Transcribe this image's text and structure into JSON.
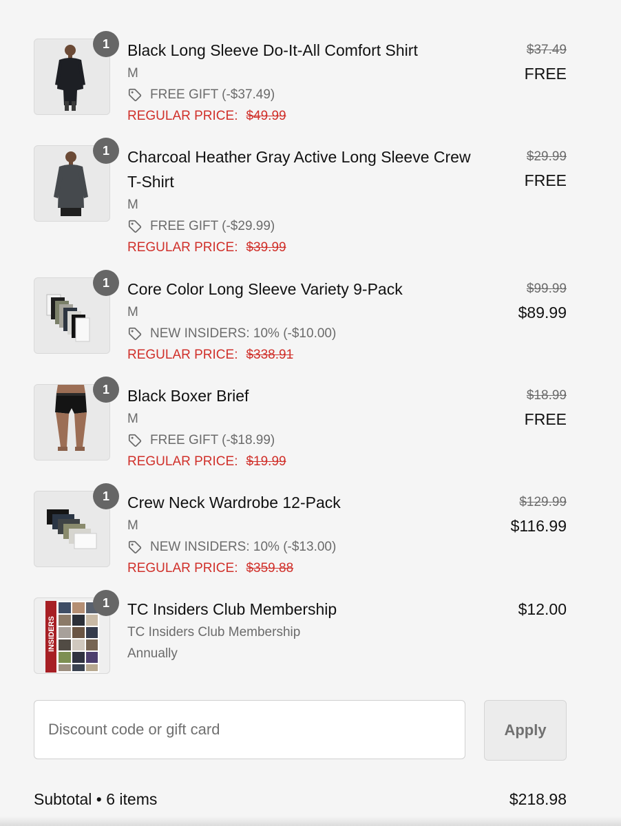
{
  "items": [
    {
      "quantity": "1",
      "title": "Black Long Sleeve Do-It-All Comfort Shirt",
      "title_line2": "",
      "variant": "M",
      "discount": "FREE GIFT (-$37.49)",
      "regular_label": "REGULAR PRICE:",
      "regular_value": "$49.99",
      "original_price": "$37.49",
      "final_price": "FREE",
      "image": "model-black-long-sleeve-shirt"
    },
    {
      "quantity": "1",
      "title": "Charcoal Heather Gray Active Long Sleeve Crew",
      "title_line2": "T-Shirt",
      "variant": "M",
      "discount": "FREE GIFT (-$29.99)",
      "regular_label": "REGULAR PRICE:",
      "regular_value": "$39.99",
      "original_price": "$29.99",
      "final_price": "FREE",
      "image": "model-charcoal-long-sleeve-tee"
    },
    {
      "quantity": "1",
      "title": "Core Color Long Sleeve Variety 9-Pack",
      "title_line2": "",
      "variant": "M",
      "discount": "NEW INSIDERS: 10% (-$10.00)",
      "regular_label": "REGULAR PRICE:",
      "regular_value": "$338.91",
      "original_price": "$99.99",
      "final_price": "$89.99",
      "image": "stack-of-long-sleeve-shirts"
    },
    {
      "quantity": "1",
      "title": "Black Boxer Brief",
      "title_line2": "",
      "variant": "M",
      "discount": "FREE GIFT (-$18.99)",
      "regular_label": "REGULAR PRICE:",
      "regular_value": "$19.99",
      "original_price": "$18.99",
      "final_price": "FREE",
      "image": "model-black-boxer-brief"
    },
    {
      "quantity": "1",
      "title": "Crew Neck Wardrobe 12-Pack",
      "title_line2": "",
      "variant": "M",
      "discount": "NEW INSIDERS: 10% (-$13.00)",
      "regular_label": "REGULAR PRICE:",
      "regular_value": "$359.88",
      "original_price": "$129.99",
      "final_price": "$116.99",
      "image": "stack-of-crew-neck-tees"
    },
    {
      "quantity": "1",
      "title": "TC Insiders Club Membership",
      "subtitle": "TC Insiders Club Membership",
      "frequency": "Annually",
      "final_price": "$12.00",
      "image_text": "INSIDERS",
      "image": "insiders-collage"
    }
  ],
  "discount_input": {
    "placeholder": "Discount code or gift card",
    "value": ""
  },
  "apply_label": "Apply",
  "subtotal": {
    "label": "Subtotal • 6 items",
    "value": "$218.98"
  },
  "icons": {
    "tag": "price-tag-icon"
  },
  "colors": {
    "regular_price": "#d0302a",
    "badge": "#666666",
    "muted_text": "#6b6b6b"
  }
}
